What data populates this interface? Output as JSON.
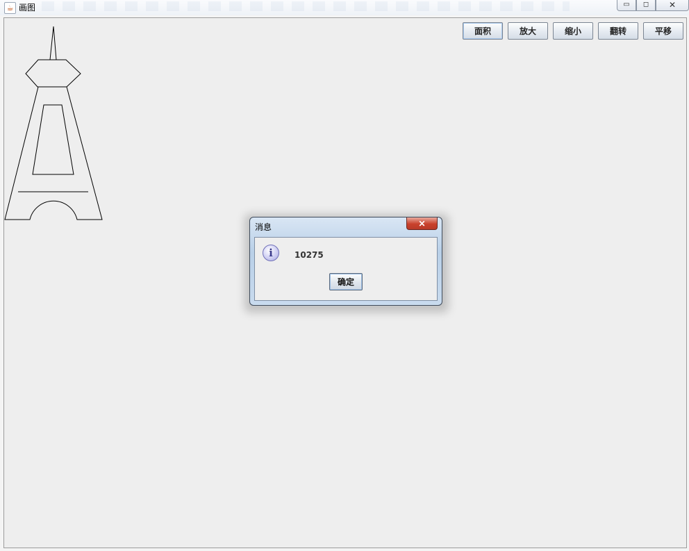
{
  "window": {
    "title": "画图",
    "icon": "java-cup-icon",
    "controls": {
      "minimize": "▭",
      "maximize": "◻",
      "close": "✕"
    }
  },
  "toolbar": {
    "area_label": "面积",
    "zoom_in_label": "放大",
    "zoom_out_label": "缩小",
    "flip_label": "翻转",
    "translate_label": "平移"
  },
  "canvas": {
    "drawing": "tower-outline"
  },
  "dialog": {
    "title": "消息",
    "message": "10275",
    "ok_label": "确定",
    "close_symbol": "✕",
    "icon": "information-icon",
    "icon_glyph": "i"
  },
  "colors": {
    "canvas_bg": "#eeeeee",
    "dialog_close": "#c9412c",
    "info_icon": "#a7a7e0"
  }
}
